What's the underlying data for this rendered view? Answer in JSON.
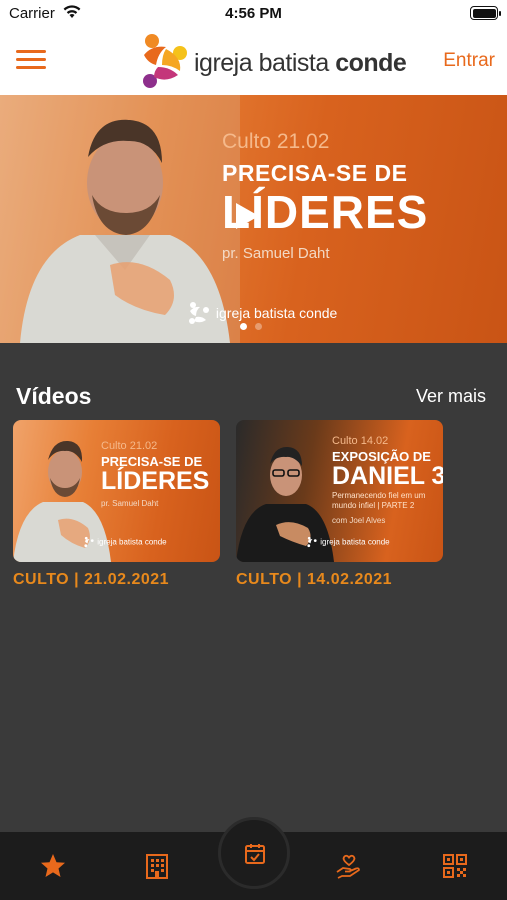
{
  "status_bar": {
    "carrier": "Carrier",
    "time": "4:56 PM",
    "icons": [
      "wifi-icon",
      "battery-icon"
    ]
  },
  "header": {
    "menu_icon": "hamburger-menu-icon",
    "logo": {
      "text_regular": "igreja batista",
      "text_bold": "conde"
    },
    "login_label": "Entrar"
  },
  "banner": {
    "subtitle": "Culto 21.02",
    "title_line1": "PRECISA-SE DE",
    "title_line2": "LÍDERES",
    "speaker": "pr. Samuel Daht",
    "brand_regular": "igreja batista",
    "brand_bold": "conde",
    "play_icon": "play-icon",
    "active_slide": 1,
    "slide_count": 2
  },
  "videos_section": {
    "title": "Vídeos",
    "see_more_label": "Ver mais",
    "items": [
      {
        "thumb_subtitle": "Culto 21.02",
        "thumb_line1": "PRECISA-SE DE",
        "thumb_line2": "LÍDERES",
        "thumb_line3": "",
        "thumb_speaker": "pr. Samuel Daht",
        "thumb_brand": "igreja batista conde",
        "caption": "CULTO | 21.02.2021"
      },
      {
        "thumb_subtitle": "Culto 14.02",
        "thumb_line1": "EXPOSIÇÃO DE",
        "thumb_line2": "DANIEL 3",
        "thumb_line3": "Permanecendo fiel em um mundo infiel | PARTE 2",
        "thumb_speaker": "com Joel Alves",
        "thumb_brand": "igreja batista conde",
        "caption": "CULTO | 14.02.2021"
      }
    ]
  },
  "tabbar": {
    "tabs": [
      "star-icon",
      "building-icon",
      "calendar-icon",
      "hand-heart-icon",
      "qr-code-icon"
    ],
    "active_color": "#e8691c"
  },
  "colors": {
    "accent": "#e8691c",
    "background": "#3a3a3a",
    "tabbar": "#1c1c1c"
  }
}
